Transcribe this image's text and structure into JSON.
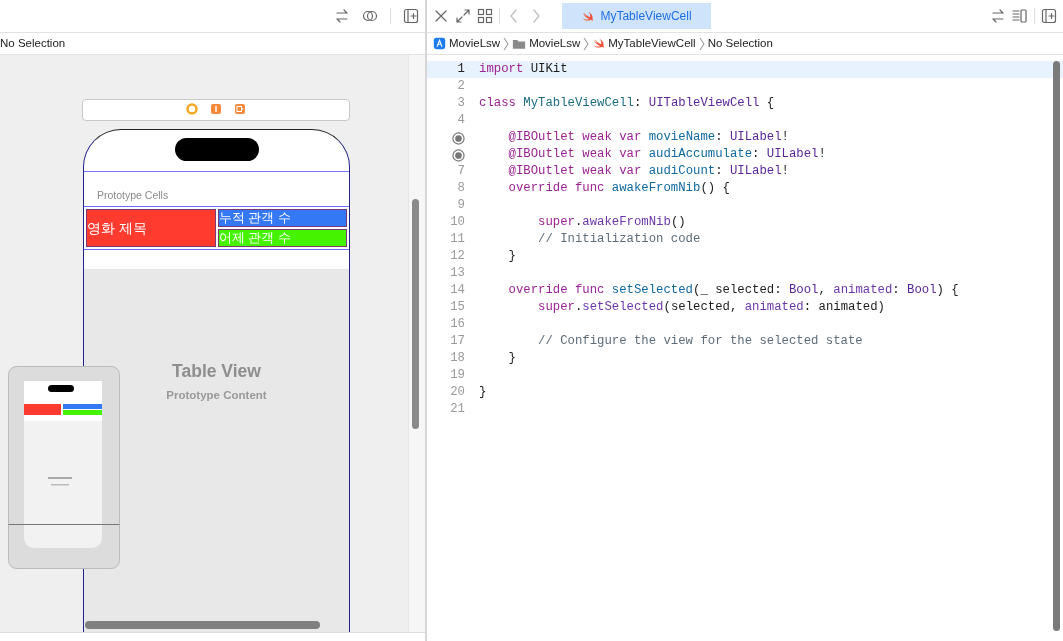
{
  "storyboard": {
    "breadcrumb": "No Selection",
    "section_header": "Prototype Cells",
    "cell_labels": [
      {
        "text": "영화 제목",
        "color": "#ff3b30"
      },
      {
        "text": "누적 관객 수",
        "color": "#3478f6"
      },
      {
        "text": "어제 관객 수",
        "color": "#45f200"
      }
    ],
    "placeholder_title": "Table View",
    "placeholder_subtitle": "Prototype Content"
  },
  "editor": {
    "tabs": [
      {
        "label": "MyTableViewCell",
        "selected": true
      }
    ],
    "breadcrumb": [
      {
        "label": "MovieLsw",
        "kind": "project"
      },
      {
        "label": "MovieLsw",
        "kind": "folder"
      },
      {
        "label": "MyTableViewCell",
        "kind": "swift"
      },
      {
        "label": "No Selection",
        "kind": "plain"
      }
    ],
    "lines": [
      {
        "number": "1",
        "current": true,
        "tokens": [
          {
            "kind": "keyword",
            "text": "import"
          },
          {
            "kind": "plain",
            "text": " UIKit"
          }
        ]
      },
      {
        "number": "2",
        "current": false
      },
      {
        "number": "3",
        "current": false,
        "tokens": [
          {
            "kind": "keyword",
            "text": "class "
          },
          {
            "kind": "decl_type",
            "text": "MyTableViewCell"
          },
          {
            "kind": "plain",
            "text": ": "
          },
          {
            "kind": "type",
            "text": "UITableViewCell"
          },
          {
            "kind": "plain",
            "text": " {"
          }
        ]
      },
      {
        "number": "4",
        "current": false
      },
      {
        "outlet": true,
        "current": false,
        "tokens": [
          {
            "kind": "keyword",
            "text": "    @IBOutlet weak var "
          },
          {
            "kind": "decl",
            "text": "movieName"
          },
          {
            "kind": "plain",
            "text": ": "
          },
          {
            "kind": "type",
            "text": "UILabel"
          },
          {
            "kind": "plain",
            "text": "!"
          }
        ]
      },
      {
        "outlet": true,
        "current": false,
        "tokens": [
          {
            "kind": "keyword",
            "text": "    @IBOutlet weak var "
          },
          {
            "kind": "decl",
            "text": "audiAccumulate"
          },
          {
            "kind": "plain",
            "text": ": "
          },
          {
            "kind": "type",
            "text": "UILabel"
          },
          {
            "kind": "plain",
            "text": "!"
          }
        ]
      },
      {
        "number": "7",
        "current": false,
        "tokens": [
          {
            "kind": "keyword",
            "text": "    @IBOutlet weak var "
          },
          {
            "kind": "decl",
            "text": "audiCount"
          },
          {
            "kind": "plain",
            "text": ": "
          },
          {
            "kind": "type",
            "text": "UILabel"
          },
          {
            "kind": "plain",
            "text": "!"
          }
        ]
      },
      {
        "number": "8",
        "current": false,
        "tokens": [
          {
            "kind": "keyword",
            "text": "    override func "
          },
          {
            "kind": "decl",
            "text": "awakeFromNib"
          },
          {
            "kind": "plain",
            "text": "() {"
          }
        ]
      },
      {
        "number": "9",
        "current": false
      },
      {
        "number": "10",
        "current": false,
        "tokens": [
          {
            "kind": "keyword",
            "text": "        super"
          },
          {
            "kind": "plain",
            "text": "."
          },
          {
            "kind": "call",
            "text": "awakeFromNib"
          },
          {
            "kind": "plain",
            "text": "()"
          }
        ]
      },
      {
        "number": "11",
        "current": false,
        "tokens": [
          {
            "kind": "comment",
            "text": "        // Initialization code"
          }
        ]
      },
      {
        "number": "12",
        "current": false,
        "tokens": [
          {
            "kind": "plain",
            "text": "    }"
          }
        ]
      },
      {
        "number": "13",
        "current": false
      },
      {
        "number": "14",
        "current": false,
        "tokens": [
          {
            "kind": "keyword",
            "text": "    override func "
          },
          {
            "kind": "decl",
            "text": "setSelected"
          },
          {
            "kind": "plain",
            "text": "(_ selected: "
          },
          {
            "kind": "type",
            "text": "Bool"
          },
          {
            "kind": "plain",
            "text": ", "
          },
          {
            "kind": "call",
            "text": "animated"
          },
          {
            "kind": "plain",
            "text": ": "
          },
          {
            "kind": "type",
            "text": "Bool"
          },
          {
            "kind": "plain",
            "text": ") {"
          }
        ]
      },
      {
        "number": "15",
        "current": false,
        "tokens": [
          {
            "kind": "keyword",
            "text": "        super"
          },
          {
            "kind": "plain",
            "text": "."
          },
          {
            "kind": "call",
            "text": "setSelected"
          },
          {
            "kind": "plain",
            "text": "(selected, "
          },
          {
            "kind": "call",
            "text": "animated"
          },
          {
            "kind": "plain",
            "text": ": animated)"
          }
        ]
      },
      {
        "number": "16",
        "current": false
      },
      {
        "number": "17",
        "current": false,
        "tokens": [
          {
            "kind": "comment",
            "text": "        // Configure the view for the selected state"
          }
        ]
      },
      {
        "number": "18",
        "current": false,
        "tokens": [
          {
            "kind": "plain",
            "text": "    }"
          }
        ]
      },
      {
        "number": "19",
        "current": false
      },
      {
        "number": "20",
        "current": false,
        "tokens": [
          {
            "kind": "plain",
            "text": "}"
          }
        ]
      },
      {
        "number": "21",
        "current": false
      }
    ]
  }
}
